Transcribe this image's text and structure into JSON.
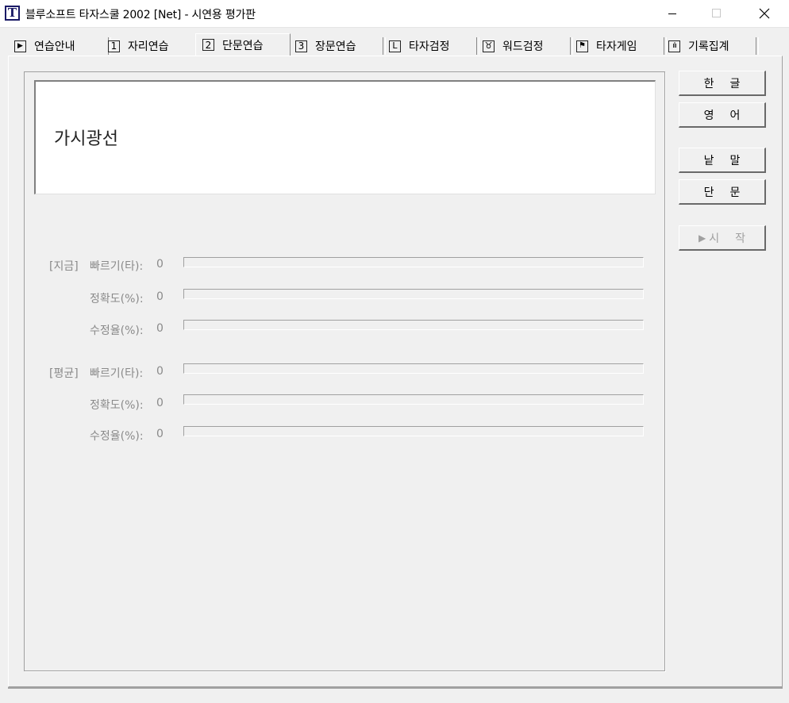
{
  "window": {
    "title": "블루소프트 타자스쿨 2002 [Net] - 시연용 평가판",
    "icon_letter": "T"
  },
  "tabs": [
    {
      "label": "연습안내",
      "icon": "play-icon",
      "glyph": "▶",
      "active": false
    },
    {
      "label": "자리연습",
      "icon": "number-1-icon",
      "glyph": "1",
      "active": false
    },
    {
      "label": "단문연습",
      "icon": "number-2-icon",
      "glyph": "2",
      "active": true
    },
    {
      "label": "장문연습",
      "icon": "number-3-icon",
      "glyph": "3",
      "active": false
    },
    {
      "label": "타자검정",
      "icon": "clock-icon",
      "glyph": "L",
      "active": false
    },
    {
      "label": "워드검정",
      "icon": "medal-icon",
      "glyph": "♉",
      "active": false
    },
    {
      "label": "타자게임",
      "icon": "flag-icon",
      "glyph": "⚑",
      "active": false
    },
    {
      "label": "기록집계",
      "icon": "bar-chart-icon",
      "glyph": "ılı",
      "active": false
    }
  ],
  "practice": {
    "sentence": "가시광선"
  },
  "stats": {
    "current": {
      "group_label": "[지금]",
      "speed_label": "빠르기(타):",
      "speed_value": "0",
      "accuracy_label": "정확도(%):",
      "accuracy_value": "0",
      "correction_label": "수정율(%):",
      "correction_value": "0",
      "speed_progress": 0,
      "accuracy_progress": 0,
      "correction_progress": 0
    },
    "average": {
      "group_label": "[평균]",
      "speed_label": "빠르기(타):",
      "speed_value": "0",
      "accuracy_label": "정확도(%):",
      "accuracy_value": "0",
      "correction_label": "수정율(%):",
      "correction_value": "0",
      "speed_progress": 0,
      "accuracy_progress": 0,
      "correction_progress": 0
    }
  },
  "buttons": {
    "korean": "한글",
    "english": "영어",
    "words": "낱말",
    "sentences": "단문",
    "start": "시작",
    "start_icon": "▶"
  }
}
